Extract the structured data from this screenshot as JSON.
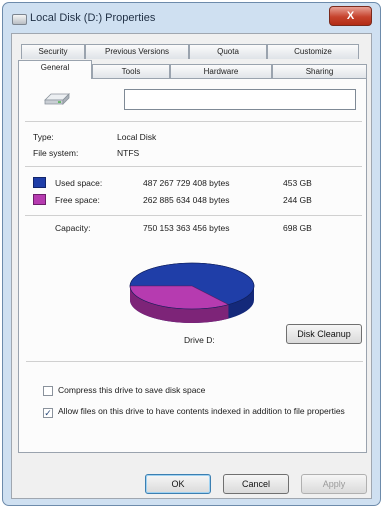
{
  "window": {
    "title": "Local Disk (D:) Properties",
    "close_label": "X"
  },
  "tabs": {
    "row_back": [
      "Security",
      "Previous Versions",
      "Quota",
      "Customize"
    ],
    "row_front": [
      "General",
      "Tools",
      "Hardware",
      "Sharing"
    ],
    "active": "General"
  },
  "general": {
    "volume_name": "",
    "type_label": "Type:",
    "type_value": "Local Disk",
    "fs_label": "File system:",
    "fs_value": "NTFS",
    "used_label": "Used space:",
    "used_bytes": "487 267 729 408 bytes",
    "used_gb": "453 GB",
    "free_label": "Free space:",
    "free_bytes": "262 885 634 048 bytes",
    "free_gb": "244 GB",
    "capacity_label": "Capacity:",
    "capacity_bytes": "750 153 363 456 bytes",
    "capacity_gb": "698 GB",
    "drive_label": "Drive D:",
    "cleanup_label": "Disk Cleanup",
    "used_fraction": 0.65,
    "compress_label": "Compress this drive to save disk space",
    "compress_checked": false,
    "index_label": "Allow files on this drive to have contents indexed in addition to file properties",
    "index_checked": true
  },
  "buttons": {
    "ok": "OK",
    "cancel": "Cancel",
    "apply": "Apply"
  },
  "colors": {
    "used": "#1f3ea8",
    "free": "#b63bb0"
  },
  "icons": {
    "title": "drive-icon",
    "drive": "hard-drive-icon",
    "close": "close-icon",
    "check": "checkmark-icon"
  }
}
